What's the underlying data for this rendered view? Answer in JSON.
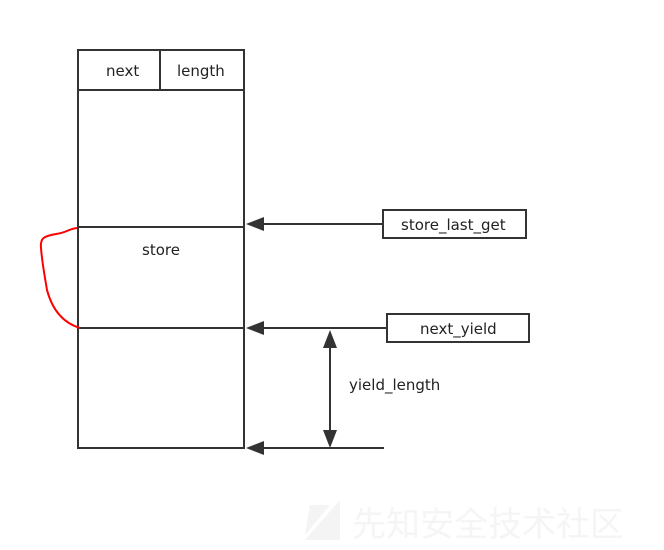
{
  "header": {
    "next": "next",
    "length": "length"
  },
  "region_label": "store",
  "pointers": {
    "store_last_get": "store_last_get",
    "next_yield": "next_yield"
  },
  "measure_label": "yield_length",
  "watermark": "先知安全技术社区",
  "colors": {
    "line": "#333333",
    "highlight": "#ff0000"
  }
}
